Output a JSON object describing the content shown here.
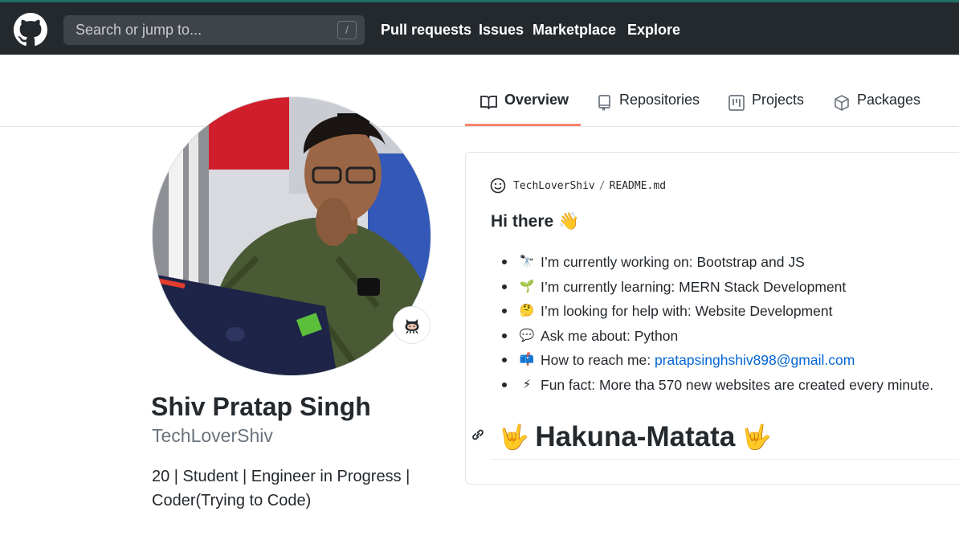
{
  "header": {
    "search_placeholder": "Search or jump to...",
    "search_shortcut": "/",
    "nav": [
      "Pull requests",
      "Issues",
      "Marketplace",
      "Explore"
    ]
  },
  "tabs": [
    {
      "label": "Overview",
      "icon": "book-icon",
      "active": true
    },
    {
      "label": "Repositories",
      "icon": "repo-icon",
      "active": false
    },
    {
      "label": "Projects",
      "icon": "project-icon",
      "active": false
    },
    {
      "label": "Packages",
      "icon": "package-icon",
      "active": false
    }
  ],
  "profile": {
    "name": "Shiv Pratap Singh",
    "username": "TechLoverShiv",
    "bio": "20 | Student | Engineer in Progress | Coder(Trying to Code)",
    "status_icon": "octocat-icon"
  },
  "readme": {
    "owner": "TechLoverShiv",
    "separator": "/",
    "file": "README.md",
    "heading": "Hi there 👋",
    "items": [
      {
        "emoji": "🔭",
        "text": "I’m currently working on: Bootstrap and JS"
      },
      {
        "emoji": "🌱",
        "text": "I’m currently learning: MERN Stack Development"
      },
      {
        "emoji": "🤔",
        "text": "I’m looking for help with: Website Development"
      },
      {
        "emoji": "💬",
        "text": "Ask me about: Python"
      },
      {
        "emoji": "📫",
        "text": "How to reach me: ",
        "link": "pratapsinghshiv898@gmail.com"
      },
      {
        "emoji": "⚡",
        "text": "Fun fact: More tha 570 new websites are created every minute."
      }
    ],
    "title": "Hakuna-Matata",
    "title_emoji": "🤟"
  },
  "colors": {
    "header_bg": "#24292e",
    "tab_active_underline": "#f9826c",
    "link": "#0366d6"
  }
}
